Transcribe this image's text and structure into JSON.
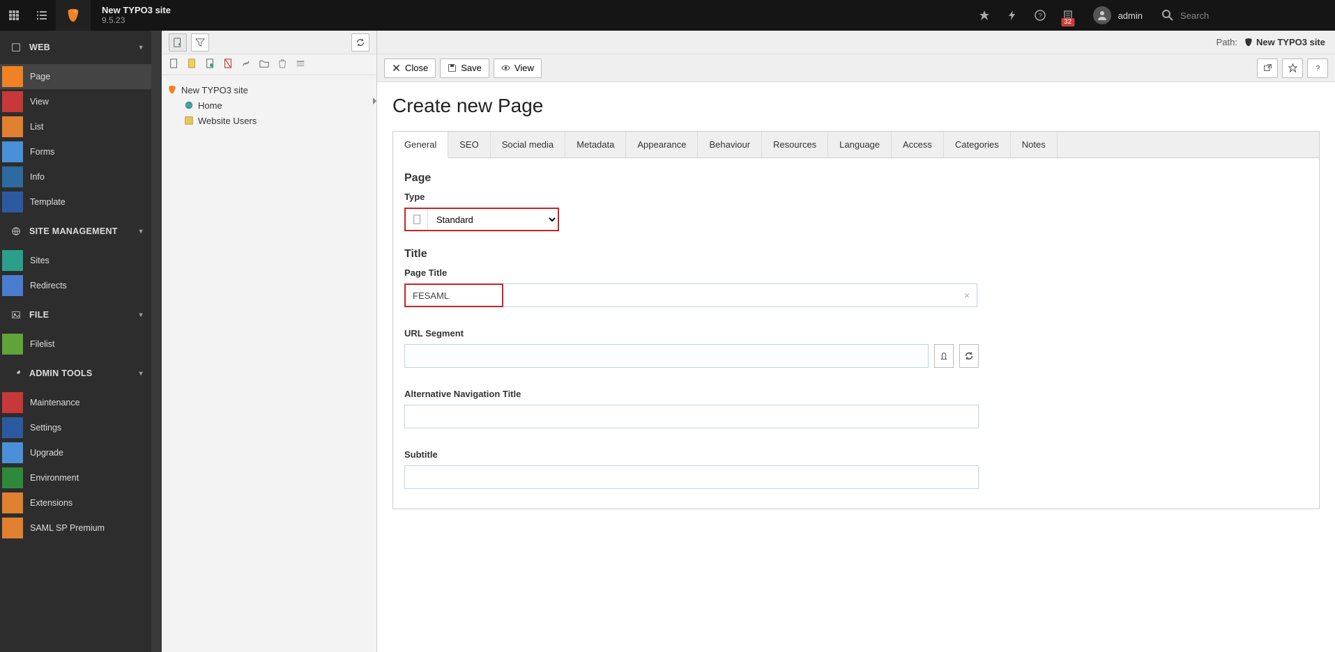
{
  "topbar": {
    "site_title": "New TYPO3 site",
    "version": "9.5.23",
    "notification_count": "32",
    "username": "admin",
    "search_placeholder": "Search"
  },
  "modmenu": {
    "groups": [
      {
        "label": "WEB",
        "items": [
          {
            "label": "Page",
            "icon_class": "ic-page",
            "active": true
          },
          {
            "label": "View",
            "icon_class": "ic-view"
          },
          {
            "label": "List",
            "icon_class": "ic-list"
          },
          {
            "label": "Forms",
            "icon_class": "ic-forms"
          },
          {
            "label": "Info",
            "icon_class": "ic-info"
          },
          {
            "label": "Template",
            "icon_class": "ic-template"
          }
        ]
      },
      {
        "label": "SITE MANAGEMENT",
        "items": [
          {
            "label": "Sites",
            "icon_class": "ic-sites"
          },
          {
            "label": "Redirects",
            "icon_class": "ic-redirects"
          }
        ]
      },
      {
        "label": "FILE",
        "items": [
          {
            "label": "Filelist",
            "icon_class": "ic-filelist"
          }
        ]
      },
      {
        "label": "ADMIN TOOLS",
        "items": [
          {
            "label": "Maintenance",
            "icon_class": "ic-maint"
          },
          {
            "label": "Settings",
            "icon_class": "ic-settings"
          },
          {
            "label": "Upgrade",
            "icon_class": "ic-upgrade"
          },
          {
            "label": "Environment",
            "icon_class": "ic-env"
          },
          {
            "label": "Extensions",
            "icon_class": "ic-ext"
          },
          {
            "label": "SAML SP Premium",
            "icon_class": "ic-samlsp"
          }
        ]
      }
    ]
  },
  "pagetree": {
    "root": "New TYPO3 site",
    "children": [
      {
        "label": "Home"
      },
      {
        "label": "Website Users"
      }
    ]
  },
  "pathbar": {
    "label": "Path:",
    "name": "New TYPO3 site"
  },
  "docheader": {
    "close": "Close",
    "save": "Save",
    "view": "View"
  },
  "form": {
    "heading": "Create new Page",
    "tabs": [
      "General",
      "SEO",
      "Social media",
      "Metadata",
      "Appearance",
      "Behaviour",
      "Resources",
      "Language",
      "Access",
      "Categories",
      "Notes"
    ],
    "section_page": "Page",
    "label_type": "Type",
    "type_value": "Standard",
    "section_title": "Title",
    "label_page_title": "Page Title",
    "page_title_value": "FESAML",
    "label_url_segment": "URL Segment",
    "url_segment_value": "",
    "label_alt_nav": "Alternative Navigation Title",
    "alt_nav_value": "",
    "label_subtitle": "Subtitle",
    "subtitle_value": ""
  }
}
